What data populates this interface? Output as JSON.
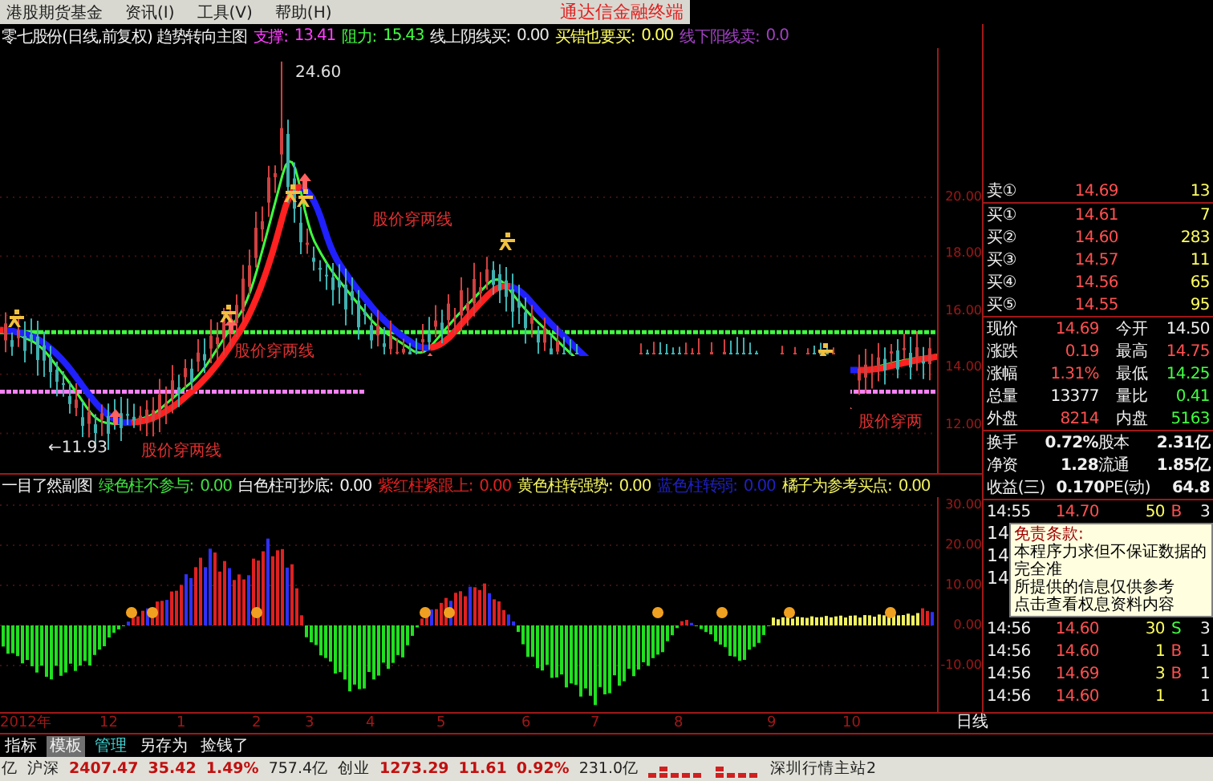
{
  "menu": {
    "items": [
      "港股期货基金",
      "资讯(I)",
      "工具(V)",
      "帮助(H)"
    ],
    "brand": "通达信金融终端"
  },
  "main_chart": {
    "title": "零七股份(日线,前复权) 趋势转向主图",
    "indicators": [
      {
        "label": "支撑:",
        "value": "13.41",
        "color": "#ff40ff"
      },
      {
        "label": "阻力:",
        "value": "15.43",
        "color": "#40ff40"
      },
      {
        "label": "线上阴线买:",
        "value": "0.00",
        "color": "#e8e8e8"
      },
      {
        "label": "买错也要买:",
        "value": "0.00",
        "color": "#ffff60"
      },
      {
        "label": "线下阳线卖:",
        "value": "0.0",
        "color": "#a040c0"
      }
    ],
    "high_label": "24.60",
    "low_label": "←11.93",
    "signal_labels": [
      "股价穿两线",
      "股价穿两线",
      "股价穿两线",
      "股价穿两"
    ],
    "axis_labels": [
      "20.00",
      "18.00",
      "16.00",
      "14.00",
      "12.00"
    ]
  },
  "sub_chart": {
    "title": "一目了然副图",
    "indicators": [
      {
        "label": "绿色柱不参与:",
        "value": "0.00",
        "color": "#40e040"
      },
      {
        "label": "白色柱可抄底:",
        "value": "0.00",
        "color": "#f0f0f0"
      },
      {
        "label": "紫红柱紧跟上:",
        "value": "0.00",
        "color": "#e02020"
      },
      {
        "label": "黄色柱转强势:",
        "value": "0.00",
        "color": "#f0f060"
      },
      {
        "label": "蓝色柱转弱:",
        "value": "0.00",
        "color": "#2020c0"
      },
      {
        "label": "橘子为参考买点:",
        "value": "0.00",
        "color": "#f0f060"
      }
    ],
    "axis_labels": [
      "30.00",
      "20.00",
      "10.00",
      "0.00",
      "-10.00"
    ]
  },
  "date_axis": {
    "labels": [
      "2012年",
      "12",
      "1",
      "2",
      "3",
      "4",
      "5",
      "6",
      "7",
      "8",
      "9",
      "10"
    ],
    "period": "日线"
  },
  "quote": {
    "ask": [
      {
        "label": "卖①",
        "price": "14.69",
        "volume": "13"
      }
    ],
    "bids": [
      {
        "label": "买①",
        "price": "14.61",
        "volume": "7"
      },
      {
        "label": "买②",
        "price": "14.60",
        "volume": "283"
      },
      {
        "label": "买③",
        "price": "14.57",
        "volume": "11"
      },
      {
        "label": "买④",
        "price": "14.56",
        "volume": "65"
      },
      {
        "label": "买⑤",
        "price": "14.55",
        "volume": "95"
      }
    ],
    "stats": [
      {
        "cells": [
          {
            "label": "现价",
            "value": "14.69",
            "color": "#ff5050"
          },
          {
            "label": "今开",
            "value": "14.50",
            "color": "#f0f0f0"
          }
        ]
      },
      {
        "cells": [
          {
            "label": "涨跌",
            "value": "0.19",
            "color": "#ff5050"
          },
          {
            "label": "最高",
            "value": "14.75",
            "color": "#ff5050"
          }
        ]
      },
      {
        "cells": [
          {
            "label": "涨幅",
            "value": "1.31%",
            "color": "#ff5050"
          },
          {
            "label": "最低",
            "value": "14.25",
            "color": "#40ff40"
          }
        ]
      },
      {
        "cells": [
          {
            "label": "总量",
            "value": "13377",
            "color": "#f0f0f0"
          },
          {
            "label": "量比",
            "value": "0.41",
            "color": "#40ff40"
          }
        ]
      },
      {
        "cells": [
          {
            "label": "外盘",
            "value": "8214",
            "color": "#ff5050"
          },
          {
            "label": "内盘",
            "value": "5163",
            "color": "#40ff40"
          }
        ]
      }
    ],
    "finance": [
      {
        "label": "换手",
        "value": "0.72%",
        "label2": "股本",
        "value2": "2.31亿"
      },
      {
        "label": "净资",
        "value": "1.28",
        "label2": "流通",
        "value2": "1.85亿"
      },
      {
        "label": "收益(三)",
        "value": "0.170",
        "label2": "PE(动)",
        "value2": "64.8"
      }
    ],
    "ticks_top": [
      {
        "time": "14:55",
        "price": "14.70",
        "volume": "50",
        "side": "B",
        "count": "3"
      }
    ],
    "ticks_covered": [
      "14",
      "14",
      "14"
    ],
    "tooltip": {
      "title": "免责条款:",
      "lines": [
        "本程序力求但不保证数据的完全准",
        "所提供的信息仅供参考",
        "点击查看权息资料内容"
      ]
    },
    "ticks": [
      {
        "time": "14:56",
        "price": "14.60",
        "volume": "30",
        "side": "S",
        "count": "3"
      },
      {
        "time": "14:56",
        "price": "14.60",
        "volume": "1",
        "side": "B",
        "count": "1"
      },
      {
        "time": "14:56",
        "price": "14.69",
        "volume": "3",
        "side": "B",
        "count": "1"
      },
      {
        "time": "14:56",
        "price": "14.60",
        "volume": "1",
        "count": "1"
      }
    ]
  },
  "tabs": [
    {
      "label": "指标",
      "selected": false,
      "kind": "tab"
    },
    {
      "label": "模板",
      "selected": true,
      "kind": "tab"
    },
    {
      "label": "管理",
      "selected": false,
      "kind": "link"
    },
    {
      "label": "另存为",
      "selected": false,
      "kind": "tab"
    },
    {
      "label": "捡钱了",
      "selected": false,
      "kind": "tab"
    }
  ],
  "status_bar": [
    {
      "kind": "text",
      "text": "亿",
      "color": "#202020"
    },
    {
      "kind": "text",
      "text": "沪深",
      "color": "#202020"
    },
    {
      "kind": "text",
      "text": "2407.47",
      "color": "#c01010"
    },
    {
      "kind": "text",
      "text": "35.42",
      "color": "#c01010"
    },
    {
      "kind": "text",
      "text": "1.49%",
      "color": "#c01010"
    },
    {
      "kind": "text",
      "text": "757.4亿",
      "color": "#202020"
    },
    {
      "kind": "text",
      "text": "创业",
      "color": "#202020"
    },
    {
      "kind": "text",
      "text": "1273.29",
      "color": "#c01010"
    },
    {
      "kind": "text",
      "text": "11.61",
      "color": "#c01010"
    },
    {
      "kind": "text",
      "text": "0.92%",
      "color": "#c01010"
    },
    {
      "kind": "text",
      "text": "231.0亿",
      "color": "#202020"
    },
    {
      "kind": "meter"
    },
    {
      "kind": "text",
      "text": "深圳行情主站2",
      "color": "#202020"
    }
  ]
}
